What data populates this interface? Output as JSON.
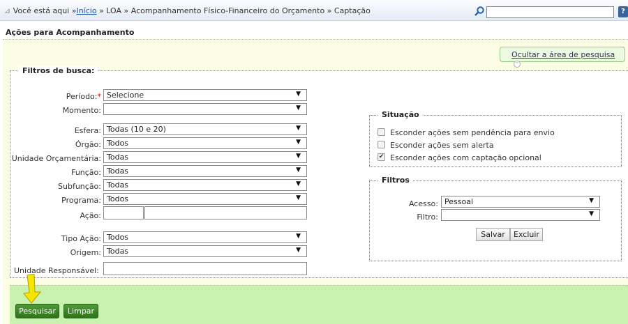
{
  "breadcrumb": {
    "prefix": "Você está aqui »",
    "home": "Início",
    "rest": " » LOA » Acompanhamento Físico-Financeiro do Orçamento » Captação"
  },
  "header": {
    "search_value": "",
    "help_label": "?"
  },
  "page_title": "Ações para Acompanhamento",
  "hide_search_label": "Ocultar a área de pesquisa",
  "filters": {
    "legend": "Filtros de busca:",
    "periodo": {
      "label": "Período:",
      "required_mark": "*",
      "value": "Selecione"
    },
    "momento": {
      "label": "Momento:",
      "value": ""
    },
    "esfera": {
      "label": "Esfera:",
      "value": "Todas (10 e 20)"
    },
    "orgao": {
      "label": "Órgão:",
      "value": "Todos"
    },
    "unidade_orc": {
      "label": "Unidade Orçamentária:",
      "value": "Todas"
    },
    "funcao": {
      "label": "Função:",
      "value": "Todas"
    },
    "subfuncao": {
      "label": "Subfunção:",
      "value": "Todas"
    },
    "programa": {
      "label": "Programa:",
      "value": "Todos"
    },
    "acao": {
      "label": "Ação:",
      "value_code": "",
      "value_desc": ""
    },
    "tipo_acao": {
      "label": "Tipo Ação:",
      "value": "Todos"
    },
    "origem": {
      "label": "Origem:",
      "value": "Todas"
    },
    "unidade_resp": {
      "label": "Unidade Responsável:",
      "value": ""
    }
  },
  "situacao": {
    "legend": "Situação",
    "items": [
      {
        "label": "Esconder ações sem pendência para envio",
        "checked": false
      },
      {
        "label": "Esconder ações sem alerta",
        "checked": false
      },
      {
        "label": "Esconder ações com captação opcional",
        "checked": true
      }
    ]
  },
  "filtros": {
    "legend": "Filtros",
    "acesso": {
      "label": "Acesso:",
      "value": "Pessoal"
    },
    "filtro": {
      "label": "Filtro:",
      "value": ""
    },
    "save_label": "Salvar",
    "delete_label": "Excluir"
  },
  "actions": {
    "search_label": "Pesquisar",
    "clear_label": "Limpar"
  },
  "icons": {
    "dropdown": "▼",
    "check": "✔",
    "up": "⌃"
  },
  "colors": {
    "panel_bg": "#fcfde5",
    "action_bar_bg": "#c9f2b0",
    "button_green": "#3a8526",
    "link_blue": "#1a56b0",
    "required_red": "#d00000",
    "pointer_yellow": "#f5e600"
  }
}
